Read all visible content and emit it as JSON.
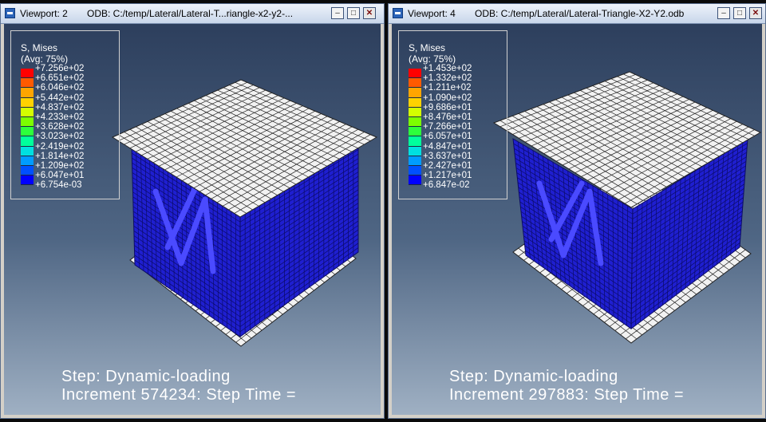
{
  "viewports": [
    {
      "viewport_label": "Viewport: 2",
      "odb_label": "ODB: C:/temp/Lateral/Lateral-T...riangle-x2-y2-...",
      "legend": {
        "title": "S, Mises",
        "subtitle": "(Avg: 75%)",
        "values": [
          "+7.256e+02",
          "+6.651e+02",
          "+6.046e+02",
          "+5.442e+02",
          "+4.837e+02",
          "+4.233e+02",
          "+3.628e+02",
          "+3.023e+02",
          "+2.419e+02",
          "+1.814e+02",
          "+1.209e+02",
          "+6.047e+01",
          "+6.754e-03"
        ]
      },
      "status_step": "Step: Dynamic-loading",
      "status_increment": "Increment     574234: Step Time ="
    },
    {
      "viewport_label": "Viewport: 4",
      "odb_label": "ODB: C:/temp/Lateral/Lateral-Triangle-X2-Y2.odb",
      "legend": {
        "title": "S, Mises",
        "subtitle": "(Avg: 75%)",
        "values": [
          "+1.453e+02",
          "+1.332e+02",
          "+1.211e+02",
          "+1.090e+02",
          "+9.686e+01",
          "+8.476e+01",
          "+7.266e+01",
          "+6.057e+01",
          "+4.847e+01",
          "+3.637e+01",
          "+2.427e+01",
          "+1.217e+01",
          "+6.847e-02"
        ]
      },
      "status_step": "Step: Dynamic-loading",
      "status_increment": "Increment     297883: Step Time ="
    }
  ],
  "colors": {
    "contour_ramp": [
      "#ff0000",
      "#ff5a00",
      "#ffa500",
      "#ffd200",
      "#d4ff00",
      "#7dff00",
      "#2dff3c",
      "#00ff9c",
      "#00e0e0",
      "#009cff",
      "#0050ff",
      "#0000ff"
    ],
    "mesh_blue": "#1f1fd0",
    "plate_white": "#f2f2f2"
  },
  "icons": {
    "system_menu": "window-system-icon",
    "minimize": "minimize-icon",
    "maximize": "maximize-icon",
    "close": "close-icon"
  }
}
